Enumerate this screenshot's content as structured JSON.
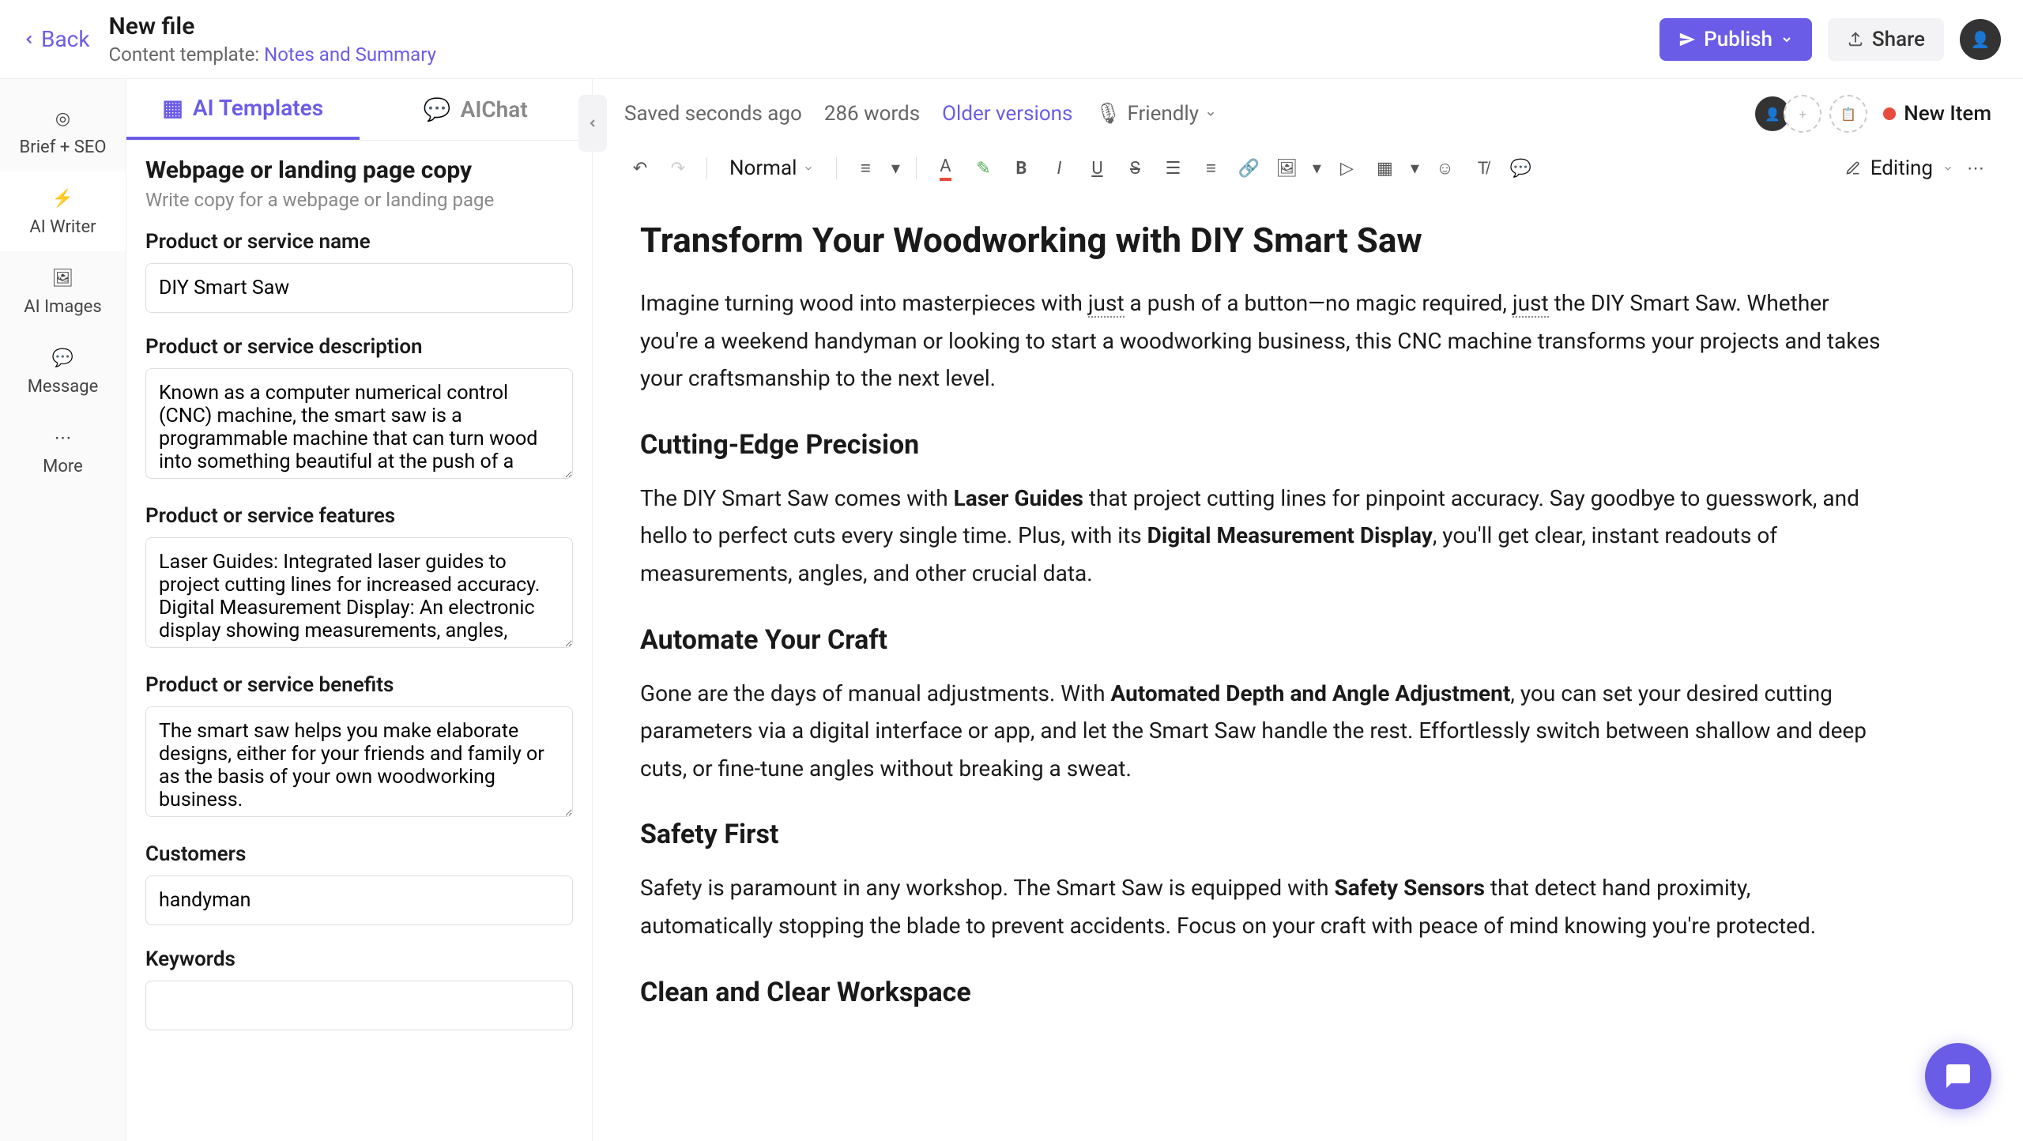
{
  "header": {
    "back_label": "Back",
    "file_title": "New file",
    "template_prefix": "Content template:",
    "template_link": "Notes and Summary",
    "publish_label": "Publish",
    "share_label": "Share"
  },
  "sidebar": {
    "items": [
      {
        "label": "Brief + SEO",
        "icon": "target-icon"
      },
      {
        "label": "AI Writer",
        "icon": "bolt-icon"
      },
      {
        "label": "AI Images",
        "icon": "image-icon"
      },
      {
        "label": "Message",
        "icon": "chat-icon"
      },
      {
        "label": "More",
        "icon": "more-icon"
      }
    ]
  },
  "panel": {
    "tabs": [
      {
        "label": "AI Templates",
        "icon": "templates-icon",
        "active": true
      },
      {
        "label": "AIChat",
        "icon": "chat-bubble-icon",
        "active": false
      }
    ],
    "heading": "Webpage or landing page copy",
    "sub": "Write copy for a webpage or landing page",
    "fields": {
      "name_label": "Product or service name",
      "name_value": "DIY Smart Saw",
      "desc_label": "Product or service description",
      "desc_value": "Known as a computer numerical control (CNC) machine, the smart saw is a programmable machine that can turn wood into something beautiful at the push of a",
      "features_label": "Product or service features",
      "features_value": "Laser Guides: Integrated laser guides to project cutting lines for increased accuracy. Digital Measurement Display: An electronic display showing measurements, angles,",
      "benefits_label": "Product or service benefits",
      "benefits_value": "The smart saw helps you make elaborate designs, either for your friends and family or as the basis of your own woodworking business.",
      "customers_label": "Customers",
      "customers_value": "handyman",
      "keywords_label": "Keywords"
    }
  },
  "editor": {
    "saved": "Saved seconds ago",
    "word_count": "286 words",
    "versions": "Older versions",
    "tone": "Friendly",
    "new_item": "New Item",
    "style_select": "Normal",
    "mode": "Editing"
  },
  "content": {
    "h1": "Transform Your Woodworking with DIY Smart Saw",
    "p1_a": "Imagine turning wood into masterpieces with ",
    "p1_just1": "just",
    "p1_b": " a push of a button—no magic required, ",
    "p1_just2": "just",
    "p1_c": " the DIY Smart Saw. Whether you're a weekend handyman or looking to start a woodworking business, this CNC machine transforms your projects and takes your craftsmanship to the next level.",
    "h2_1": "Cutting-Edge Precision",
    "p2_a": "The DIY Smart Saw comes with ",
    "p2_b1": "Laser Guides",
    "p2_c": " that project cutting lines for pinpoint accuracy. Say goodbye to guesswork, and hello to perfect cuts every single time. Plus, with its ",
    "p2_b2": "Digital Measurement Display",
    "p2_d": ", you'll get clear, instant readouts of measurements, angles, and other crucial data.",
    "h2_2": "Automate Your Craft",
    "p3_a": "Gone are the days of manual adjustments. With ",
    "p3_b1": "Automated Depth and Angle Adjustment",
    "p3_c": ", you can set your desired cutting parameters via a digital interface or app, and let the Smart Saw handle the rest. Effortlessly switch between shallow and deep cuts, or fine-tune angles without breaking a sweat.",
    "h2_3": "Safety First",
    "p4_a": "Safety is paramount in any workshop. The Smart Saw is equipped with ",
    "p4_b1": "Safety Sensors",
    "p4_c": " that detect hand proximity, automatically stopping the blade to prevent accidents. Focus on your craft with peace of mind knowing you're protected.",
    "h2_4": "Clean and Clear Workspace"
  }
}
